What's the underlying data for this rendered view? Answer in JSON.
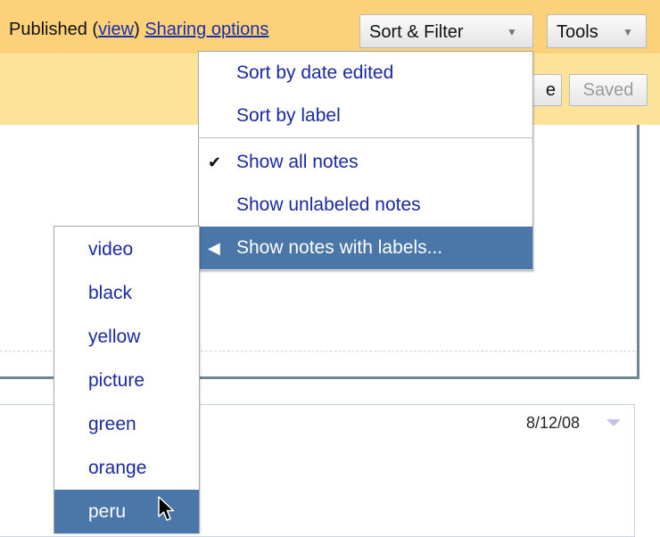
{
  "toolbar": {
    "published_label": "Published",
    "view_paren_open": "(",
    "view_link": "view",
    "view_paren_close": ")",
    "sharing_options": "Sharing options",
    "sort_filter_button": "Sort & Filter",
    "tools_button": "Tools",
    "caret": "▼"
  },
  "toolbar2": {
    "partial_button": "e",
    "saved_button": "Saved"
  },
  "notes": [
    {
      "date": "8/12/08"
    }
  ],
  "sort_menu": {
    "items": [
      {
        "label": "Sort by date edited",
        "mark": ""
      },
      {
        "label": "Sort by label",
        "mark": ""
      },
      {
        "label": "Show all notes",
        "mark": "✔"
      },
      {
        "label": "Show unlabeled notes",
        "mark": ""
      },
      {
        "label": "Show notes with labels...",
        "mark": "◀"
      }
    ]
  },
  "labels_submenu": {
    "items": [
      "video",
      "black",
      "yellow",
      "picture",
      "green",
      "orange",
      "peru"
    ],
    "highlighted": "peru"
  },
  "colors": {
    "toolbar_bg": "#fcd17a",
    "menu_highlight": "#4a76a8",
    "link": "#1a2aa0"
  }
}
